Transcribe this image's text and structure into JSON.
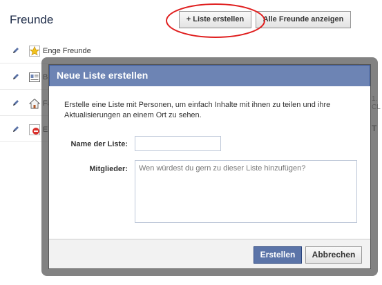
{
  "page": {
    "title": "Freunde"
  },
  "toolbar": {
    "create_list_plus": "+",
    "create_list_label": "Liste erstellen",
    "all_friends_label": "Alle Freunde anzeigen"
  },
  "lists": [
    {
      "label": "Enge Freunde",
      "icon": "star-icon"
    },
    {
      "label": "Be",
      "icon": "contact-card-icon"
    },
    {
      "label": "Fa",
      "icon": "house-icon"
    },
    {
      "label": "Ei",
      "icon": "blocked-icon"
    }
  ],
  "background_fragments": [
    "1.",
    "CL",
    "T"
  ],
  "dialog": {
    "title": "Neue Liste erstellen",
    "description": "Erstelle eine Liste mit Personen, um einfach Inhalte mit ihnen zu teilen und ihre Aktualisierungen an einem Ort zu sehen.",
    "name_label": "Name der Liste:",
    "name_value": "",
    "members_label": "Mitglieder:",
    "members_placeholder": "Wen würdest du gern zu dieser Liste hinzufügen?",
    "submit_label": "Erstellen",
    "cancel_label": "Abbrechen"
  },
  "colors": {
    "header_blue": "#6d84b4",
    "primary_button": "#5b74a8",
    "highlight_ring": "#e02020"
  }
}
